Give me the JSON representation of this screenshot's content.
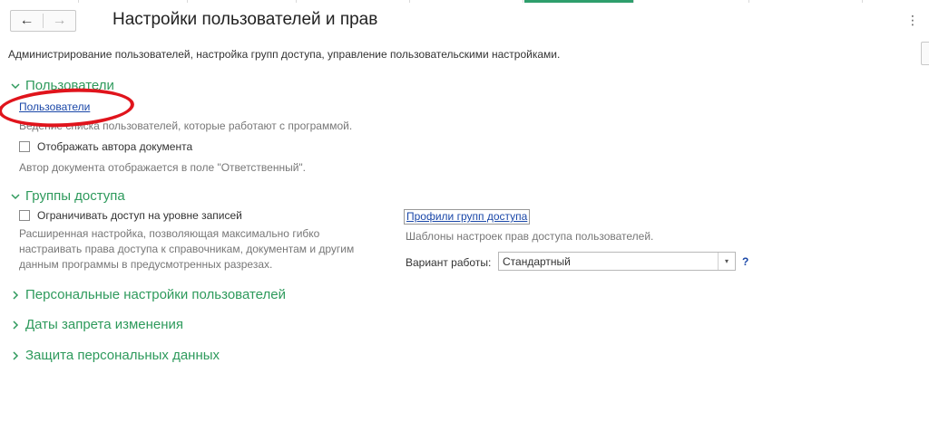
{
  "window": {
    "title": "Настройки пользователей и прав",
    "description": "Администрирование пользователей, настройка групп доступа, управление пользовательскими настройками."
  },
  "nav": {
    "back_icon": "arrow-left-icon",
    "forward_icon": "arrow-right-icon",
    "more_icon": "kebab-menu-icon"
  },
  "sections": {
    "users": {
      "title": "Пользователи",
      "expanded": true,
      "link": "Пользователи",
      "link_hint": "Ведение списка пользователей, которые работают с программой.",
      "checkbox_label": "Отображать автора документа",
      "checkbox_checked": false,
      "checkbox_hint": "Автор документа отображается в поле \"Ответственный\"."
    },
    "access_groups": {
      "title": "Группы доступа",
      "expanded": true,
      "checkbox_label": "Ограничивать доступ на уровне записей",
      "checkbox_checked": false,
      "hint_lines": [
        "Расширенная настройка, позволяющая максимально гибко",
        "настраивать права доступа к справочникам, документам и другим",
        "данным программы в предусмотренных разрезах."
      ],
      "profiles_link": "Профили групп доступа",
      "profiles_hint": "Шаблоны настроек прав доступа пользователей.",
      "mode_label": "Вариант работы:",
      "mode_value": "Стандартный",
      "help_label": "?"
    },
    "personal_settings": {
      "title": "Персональные настройки пользователей",
      "expanded": false
    },
    "change_dates": {
      "title": "Даты запрета изменения",
      "expanded": false
    },
    "personal_data": {
      "title": "Защита персональных данных",
      "expanded": false
    }
  },
  "colors": {
    "section": "#2e9a5c",
    "link": "#1a47a8",
    "annotation": "#e0141c",
    "active_tab": "#2e9e6c"
  }
}
